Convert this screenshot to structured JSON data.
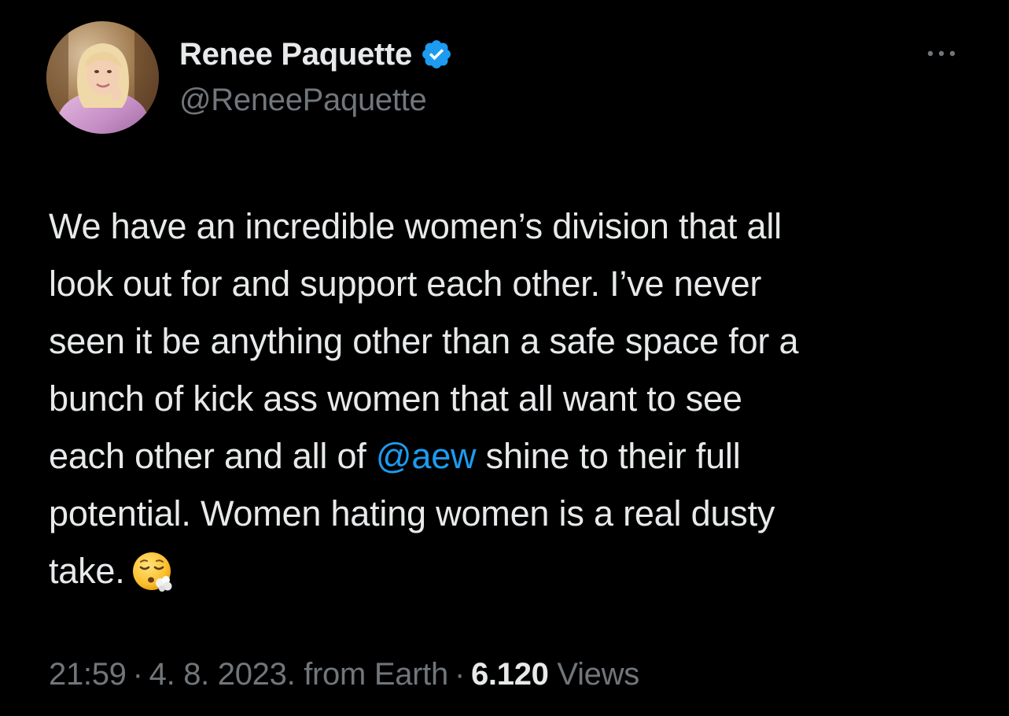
{
  "user": {
    "display_name": "Renee Paquette",
    "handle": "@ReneePaquette",
    "verified": true,
    "verified_icon": "verified-badge-icon",
    "avatar_icon": "profile-avatar"
  },
  "more_icon": "more-horizontal-icon",
  "tweet": {
    "lines": [
      "We have an incredible women’s division that all",
      "look out for and support each other. I’ve never",
      "seen it be anything other than a safe space for a",
      "bunch of kick ass women that all want to see"
    ],
    "line5_before": "each other and all of ",
    "mention": "@aew",
    "line5_after": " shine to their full",
    "line6": "potential. Women hating women is a real dusty",
    "line7": "take.",
    "emoji": "face-exhaling-emoji"
  },
  "meta": {
    "time": "21:59",
    "date": "4. 8. 2023.",
    "source": "from Earth",
    "views_count": "6.120",
    "views_label": "Views",
    "separator": "·"
  },
  "colors": {
    "background": "#000000",
    "text": "#e7e9ea",
    "secondary": "#71767b",
    "accent": "#1d9bf0"
  }
}
